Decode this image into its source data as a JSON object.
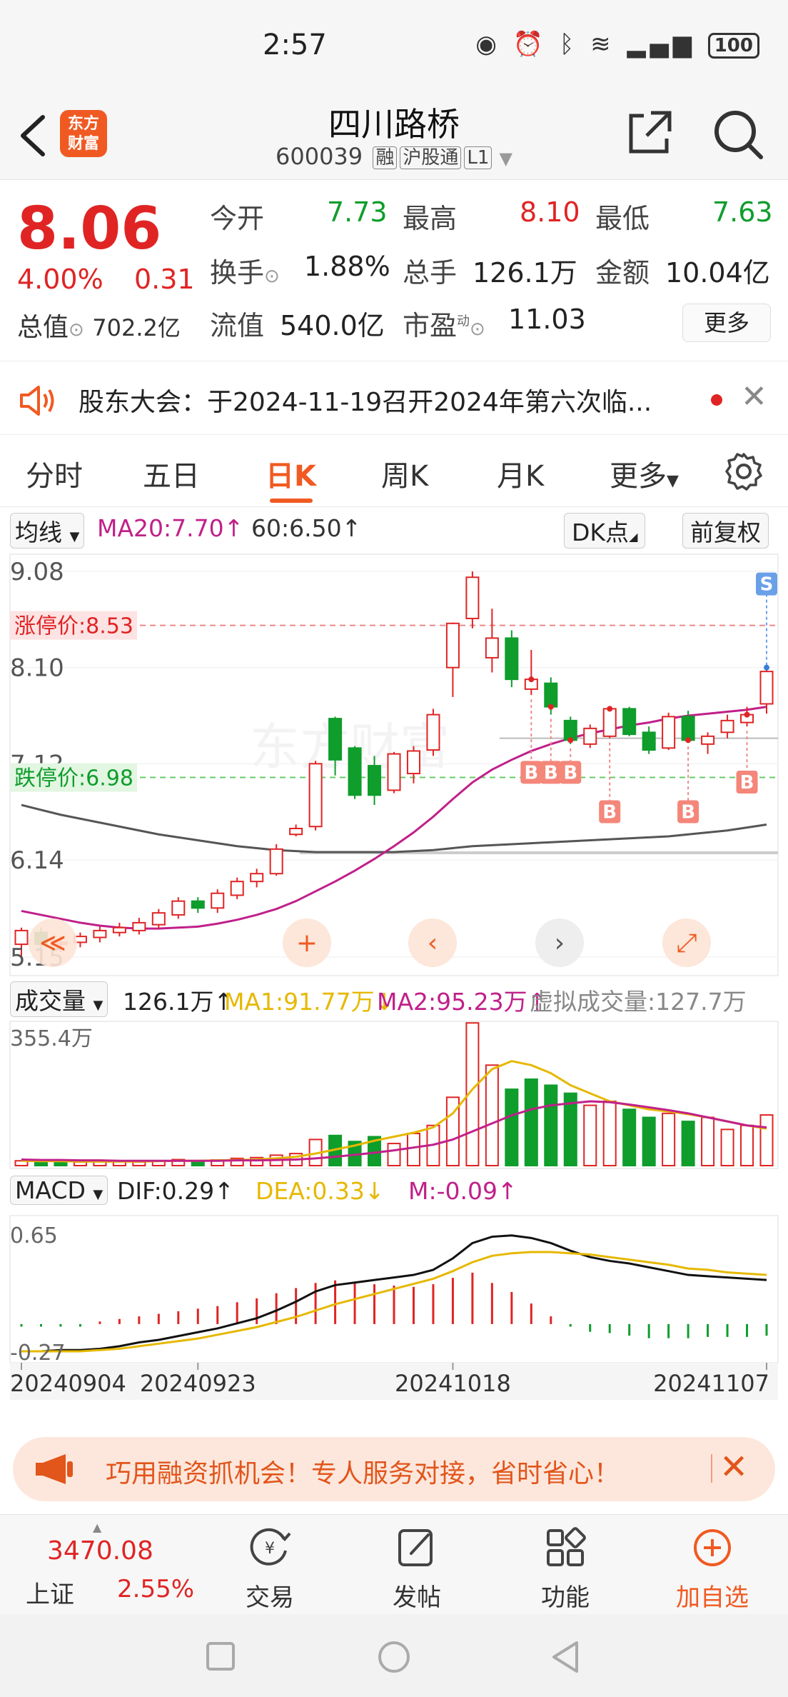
{
  "status": {
    "time": "2:57",
    "battery": "100"
  },
  "header": {
    "title": "四川路桥",
    "code": "600039",
    "tags": [
      "融",
      "沪股通",
      "L1"
    ],
    "logo_line1": "东方",
    "logo_line2": "财富"
  },
  "quote": {
    "price": "8.06",
    "pct": "4.00%",
    "change": "0.31",
    "mktcap_label": "总值",
    "mktcap_value": "702.2亿",
    "open_label": "今开",
    "open_value": "7.73",
    "high_label": "最高",
    "high_value": "8.10",
    "low_label": "最低",
    "low_value": "7.63",
    "turnover_label": "换手",
    "turnover_value": "1.88%",
    "volume_label": "总手",
    "volume_value": "126.1万",
    "amount_label": "金额",
    "amount_value": "10.04亿",
    "float_label": "流值",
    "float_value": "540.0亿",
    "pe_label": "市盈",
    "pe_sup": "动",
    "pe_value": "11.03",
    "more_label": "更多"
  },
  "notice": {
    "text": "股东大会：于2024-11-19召开2024年第六次临..."
  },
  "tabs": [
    "分时",
    "五日",
    "日K",
    "周K",
    "月K",
    "更多"
  ],
  "active_tab": "日K",
  "kline_bar": {
    "selector": "均线",
    "ma20": "MA20:7.70↑",
    "ma60": "60:6.50↑",
    "dk_button": "DK点",
    "adjust_button": "前复权"
  },
  "volume_bar": {
    "selector": "成交量",
    "value": "126.1万↑",
    "ma1": "MA1:91.77万↓",
    "ma2": "MA2:95.23万↑",
    "virtual": "虚拟成交量:127.7万"
  },
  "macd_bar": {
    "selector": "MACD",
    "dif": "DIF:0.29↑",
    "dea": "DEA:0.33↓",
    "m": "M:-0.09↑"
  },
  "chart_labels": {
    "y_ticks": [
      "9.08",
      "8.10",
      "7.12",
      "6.14",
      "5.15"
    ],
    "limit_up": "涨停价:8.53",
    "limit_down": "跌停价:6.98",
    "vol_max": "355.4万",
    "macd_top": "0.65",
    "macd_bottom": "-0.27",
    "dates": [
      "20240904",
      "20240923",
      "20241018",
      "20241107"
    ],
    "b_marker": "B",
    "s_marker": "S"
  },
  "colors": {
    "up": "#e02424",
    "down": "#0f9d2c",
    "ma20": "#c0208a",
    "ma60": "#555555",
    "accent": "#f05a22",
    "dea": "#e6b800"
  },
  "chart_data": {
    "type": "candlestick",
    "ylim": [
      5.15,
      9.08
    ],
    "candles": [
      {
        "o": 5.28,
        "c": 5.42,
        "h": 5.45,
        "l": 5.15
      },
      {
        "o": 5.4,
        "c": 5.28,
        "h": 5.45,
        "l": 5.22
      },
      {
        "o": 5.28,
        "c": 5.3,
        "h": 5.36,
        "l": 5.2
      },
      {
        "o": 5.3,
        "c": 5.36,
        "h": 5.4,
        "l": 5.25
      },
      {
        "o": 5.35,
        "c": 5.42,
        "h": 5.46,
        "l": 5.3
      },
      {
        "o": 5.4,
        "c": 5.45,
        "h": 5.5,
        "l": 5.36
      },
      {
        "o": 5.42,
        "c": 5.5,
        "h": 5.55,
        "l": 5.38
      },
      {
        "o": 5.48,
        "c": 5.6,
        "h": 5.64,
        "l": 5.44
      },
      {
        "o": 5.58,
        "c": 5.72,
        "h": 5.76,
        "l": 5.54
      },
      {
        "o": 5.72,
        "c": 5.65,
        "h": 5.76,
        "l": 5.6
      },
      {
        "o": 5.65,
        "c": 5.8,
        "h": 5.84,
        "l": 5.6
      },
      {
        "o": 5.78,
        "c": 5.92,
        "h": 5.96,
        "l": 5.74
      },
      {
        "o": 5.92,
        "c": 6.0,
        "h": 6.05,
        "l": 5.86
      },
      {
        "o": 6.0,
        "c": 6.25,
        "h": 6.3,
        "l": 5.98
      },
      {
        "o": 6.4,
        "c": 6.46,
        "h": 6.5,
        "l": 6.38
      },
      {
        "o": 6.48,
        "c": 7.12,
        "h": 7.15,
        "l": 6.44
      },
      {
        "o": 7.58,
        "c": 7.16,
        "h": 7.6,
        "l": 7.0
      },
      {
        "o": 7.28,
        "c": 6.8,
        "h": 7.3,
        "l": 6.76
      },
      {
        "o": 7.1,
        "c": 6.8,
        "h": 7.2,
        "l": 6.7
      },
      {
        "o": 6.85,
        "c": 7.22,
        "h": 7.24,
        "l": 6.82
      },
      {
        "o": 7.02,
        "c": 7.25,
        "h": 7.3,
        "l": 6.92
      },
      {
        "o": 7.26,
        "c": 7.62,
        "h": 7.68,
        "l": 7.2
      },
      {
        "o": 8.1,
        "c": 8.55,
        "h": 8.56,
        "l": 7.8
      },
      {
        "o": 8.6,
        "c": 9.02,
        "h": 9.08,
        "l": 8.5
      },
      {
        "o": 8.2,
        "c": 8.4,
        "h": 8.7,
        "l": 8.05
      },
      {
        "o": 8.4,
        "c": 7.98,
        "h": 8.48,
        "l": 7.9
      },
      {
        "o": 7.88,
        "c": 7.98,
        "h": 8.28,
        "l": 7.82
      },
      {
        "o": 7.94,
        "c": 7.7,
        "h": 8.0,
        "l": 7.62
      },
      {
        "o": 7.56,
        "c": 7.36,
        "h": 7.6,
        "l": 7.32
      },
      {
        "o": 7.32,
        "c": 7.48,
        "h": 7.52,
        "l": 7.28
      },
      {
        "o": 7.4,
        "c": 7.68,
        "h": 7.7,
        "l": 7.38
      },
      {
        "o": 7.68,
        "c": 7.42,
        "h": 7.7,
        "l": 7.4
      },
      {
        "o": 7.44,
        "c": 7.26,
        "h": 7.5,
        "l": 7.22
      },
      {
        "o": 7.28,
        "c": 7.6,
        "h": 7.64,
        "l": 7.26
      },
      {
        "o": 7.6,
        "c": 7.36,
        "h": 7.66,
        "l": 7.34
      },
      {
        "o": 7.32,
        "c": 7.4,
        "h": 7.44,
        "l": 7.22
      },
      {
        "o": 7.44,
        "c": 7.56,
        "h": 7.62,
        "l": 7.38
      },
      {
        "o": 7.54,
        "c": 7.62,
        "h": 7.7,
        "l": 7.5
      },
      {
        "o": 7.73,
        "c": 8.06,
        "h": 8.1,
        "l": 7.63
      }
    ],
    "ma20": [
      5.62,
      5.58,
      5.54,
      5.5,
      5.47,
      5.45,
      5.44,
      5.44,
      5.45,
      5.46,
      5.49,
      5.53,
      5.58,
      5.64,
      5.72,
      5.82,
      5.92,
      6.03,
      6.15,
      6.28,
      6.42,
      6.58,
      6.76,
      6.93,
      7.06,
      7.16,
      7.25,
      7.32,
      7.38,
      7.43,
      7.47,
      7.51,
      7.54,
      7.58,
      7.61,
      7.63,
      7.65,
      7.67,
      7.7
    ],
    "ma60": [
      6.7,
      6.65,
      6.6,
      6.56,
      6.52,
      6.48,
      6.44,
      6.4,
      6.37,
      6.34,
      6.31,
      6.28,
      6.26,
      6.24,
      6.23,
      6.22,
      6.22,
      6.22,
      6.22,
      6.22,
      6.23,
      6.24,
      6.26,
      6.28,
      6.29,
      6.3,
      6.31,
      6.32,
      6.33,
      6.34,
      6.35,
      6.36,
      6.37,
      6.38,
      6.4,
      6.42,
      6.44,
      6.47,
      6.5
    ],
    "volume": [
      12,
      10,
      8,
      9,
      11,
      10,
      9,
      12,
      15,
      11,
      14,
      18,
      20,
      26,
      30,
      65,
      75,
      60,
      72,
      55,
      80,
      100,
      170,
      355,
      250,
      190,
      215,
      200,
      180,
      150,
      160,
      140,
      120,
      130,
      110,
      120,
      90,
      100,
      126
    ],
    "vol_up": [
      true,
      false,
      false,
      true,
      true,
      true,
      true,
      true,
      true,
      false,
      true,
      true,
      true,
      true,
      true,
      true,
      false,
      false,
      false,
      true,
      true,
      true,
      true,
      true,
      true,
      false,
      false,
      false,
      false,
      true,
      true,
      false,
      false,
      true,
      false,
      true,
      true,
      true,
      true
    ],
    "vol_ma1": [
      12,
      11,
      11,
      10,
      10,
      10,
      10,
      11,
      12,
      12,
      13,
      14,
      15,
      18,
      22,
      30,
      40,
      50,
      62,
      72,
      82,
      95,
      130,
      190,
      240,
      260,
      250,
      230,
      200,
      180,
      160,
      150,
      140,
      135,
      128,
      120,
      110,
      100,
      92
    ],
    "vol_ma2": [
      15,
      14,
      14,
      13,
      13,
      12,
      12,
      12,
      12,
      12,
      12,
      13,
      13,
      14,
      15,
      18,
      22,
      27,
      32,
      38,
      45,
      52,
      65,
      85,
      105,
      125,
      140,
      150,
      155,
      160,
      158,
      152,
      145,
      138,
      130,
      120,
      110,
      100,
      95
    ],
    "macd_m": [
      -0.02,
      -0.02,
      -0.02,
      -0.02,
      0.02,
      0.04,
      0.06,
      0.08,
      0.1,
      0.12,
      0.14,
      0.17,
      0.2,
      0.24,
      0.28,
      0.32,
      0.34,
      0.33,
      0.31,
      0.3,
      0.29,
      0.31,
      0.36,
      0.4,
      0.32,
      0.25,
      0.16,
      0.06,
      -0.02,
      -0.06,
      -0.07,
      -0.09,
      -0.11,
      -0.11,
      -0.11,
      -0.1,
      -0.1,
      -0.1,
      -0.09
    ],
    "macd_dif": [
      -0.27,
      -0.27,
      -0.26,
      -0.26,
      -0.25,
      -0.23,
      -0.2,
      -0.18,
      -0.15,
      -0.12,
      -0.09,
      -0.05,
      -0.01,
      0.05,
      0.12,
      0.2,
      0.25,
      0.27,
      0.29,
      0.31,
      0.33,
      0.37,
      0.46,
      0.58,
      0.63,
      0.64,
      0.62,
      0.58,
      0.52,
      0.47,
      0.44,
      0.42,
      0.39,
      0.36,
      0.33,
      0.32,
      0.31,
      0.3,
      0.29
    ],
    "macd_dea": [
      -0.27,
      -0.27,
      -0.27,
      -0.27,
      -0.26,
      -0.25,
      -0.23,
      -0.21,
      -0.19,
      -0.17,
      -0.14,
      -0.11,
      -0.08,
      -0.04,
      0.0,
      0.05,
      0.1,
      0.14,
      0.18,
      0.22,
      0.26,
      0.3,
      0.36,
      0.43,
      0.48,
      0.5,
      0.51,
      0.51,
      0.5,
      0.49,
      0.47,
      0.45,
      0.43,
      0.41,
      0.38,
      0.37,
      0.35,
      0.34,
      0.33
    ],
    "b_markers": [
      26,
      27,
      28,
      30,
      34,
      37
    ],
    "s_markers": [
      38
    ],
    "date_indices": [
      0,
      9,
      22,
      38
    ]
  },
  "promo": {
    "text": "巧用融资抓机会！专人服务对接，省时省心！"
  },
  "bottom_nav": {
    "index_value": "3470.08",
    "index_name": "上证",
    "index_pct": "2.55%",
    "items": [
      "交易",
      "发帖",
      "功能",
      "加自选"
    ]
  }
}
